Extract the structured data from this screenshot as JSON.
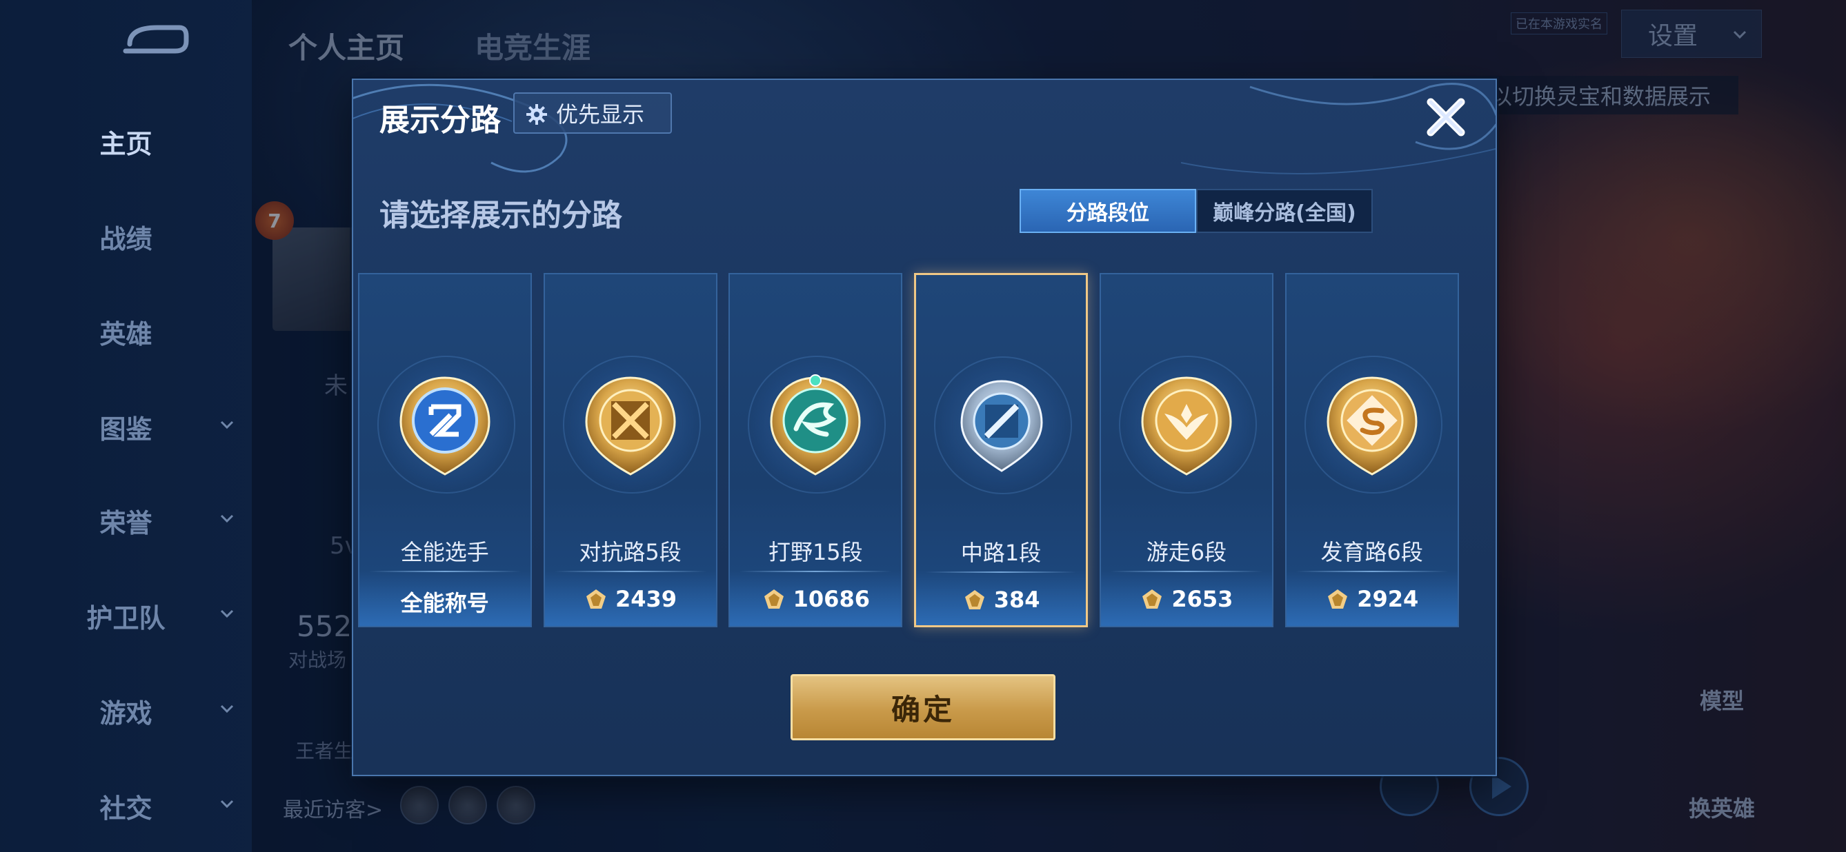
{
  "nav": {
    "items": [
      {
        "label": "主页",
        "active": true,
        "expandable": false
      },
      {
        "label": "战绩",
        "active": false,
        "expandable": false
      },
      {
        "label": "英雄",
        "active": false,
        "expandable": false
      },
      {
        "label": "图鉴",
        "active": false,
        "expandable": true
      },
      {
        "label": "荣誉",
        "active": false,
        "expandable": true
      },
      {
        "label": "护卫队",
        "active": false,
        "expandable": true
      },
      {
        "label": "游戏",
        "active": false,
        "expandable": true
      },
      {
        "label": "社交",
        "active": false,
        "expandable": true
      }
    ]
  },
  "header": {
    "tabs": [
      {
        "label": "个人主页",
        "active": true
      },
      {
        "label": "电竞生涯",
        "active": false
      }
    ],
    "settings_label": "设置",
    "game_badge": "已在本游戏实名",
    "hint_text": "以切换灵宝和数据展示"
  },
  "profile_bg": {
    "level": "7",
    "status_fragment": "未",
    "mode_fragment": "5v",
    "matches_value": "552",
    "matches_label": "对战场",
    "king_label": "王者生",
    "recent_visitors_label": "最近访客>"
  },
  "right_buttons": {
    "model_label": "模型",
    "switch_hero_label": "换英雄"
  },
  "modal": {
    "title": "展示分路",
    "priority_button": "优先显示",
    "subtitle": "请选择展示的分路",
    "toggle": {
      "active": "分路段位",
      "inactive": "巅峰分路(全国)"
    },
    "cards": [
      {
        "label": "全能选手",
        "value": "全能称号",
        "has_medal_icon": false,
        "selected": false,
        "emblem": "all-round-emblem"
      },
      {
        "label": "对抗路5段",
        "value": "2439",
        "has_medal_icon": true,
        "selected": false,
        "emblem": "clash-lane-emblem"
      },
      {
        "label": "打野15段",
        "value": "10686",
        "has_medal_icon": true,
        "selected": false,
        "emblem": "jungle-emblem"
      },
      {
        "label": "中路1段",
        "value": "384",
        "has_medal_icon": true,
        "selected": true,
        "emblem": "mid-lane-emblem"
      },
      {
        "label": "游走6段",
        "value": "2653",
        "has_medal_icon": true,
        "selected": false,
        "emblem": "roam-emblem"
      },
      {
        "label": "发育路6段",
        "value": "2924",
        "has_medal_icon": true,
        "selected": false,
        "emblem": "farm-lane-emblem"
      }
    ],
    "confirm_button": "确定"
  },
  "colors": {
    "accent_gold": "#f0c886",
    "accent_blue": "#3e86d6",
    "modal_bg": "#1f3c68"
  }
}
